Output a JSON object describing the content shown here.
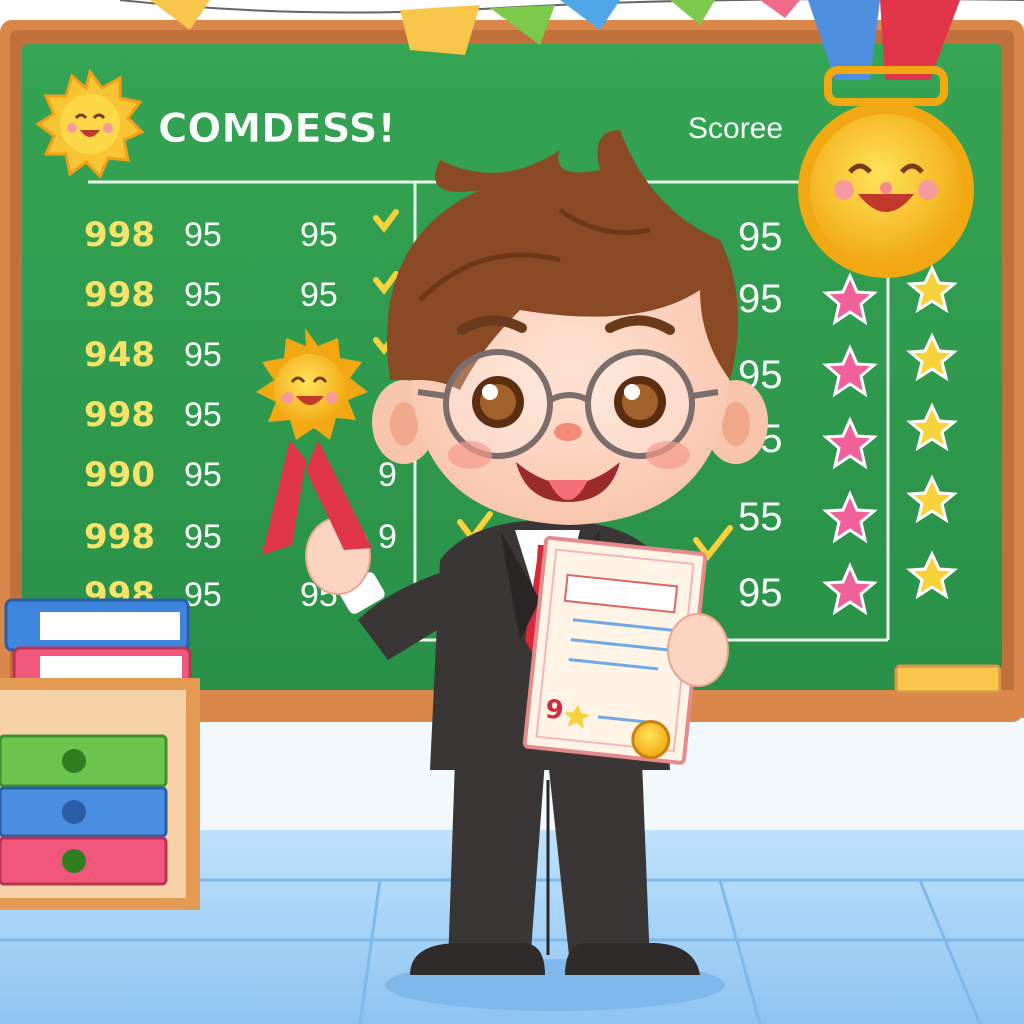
{
  "board": {
    "title": "COMDESS!",
    "score_label": "Scoree"
  },
  "scores": {
    "left_col": [
      "998",
      "998",
      "948",
      "998",
      "990",
      "998",
      "998"
    ],
    "mid_col": [
      "95",
      "95",
      "95",
      "95",
      "95",
      "95",
      "95"
    ],
    "third_col": [
      "95",
      "95",
      "",
      "",
      "9",
      "9",
      "95"
    ],
    "right_col": [
      "95",
      "95",
      "95",
      "95",
      "55",
      "",
      "95"
    ]
  },
  "certificate": {
    "number": "9"
  },
  "colors": {
    "board_green": "#2f9e4e",
    "frame_wood": "#d9874a",
    "suit": "#3a3636",
    "tie": "#d8283c",
    "gold": "#f3b81f",
    "star_pink": "#f0609a",
    "star_yellow": "#f7d23b",
    "floor_blue": "#9fd0f6"
  },
  "icons": [
    "sun-icon",
    "medal-icon",
    "ribbon-badge-icon",
    "star-icon",
    "check-icon",
    "book-icon",
    "folder-icon"
  ]
}
